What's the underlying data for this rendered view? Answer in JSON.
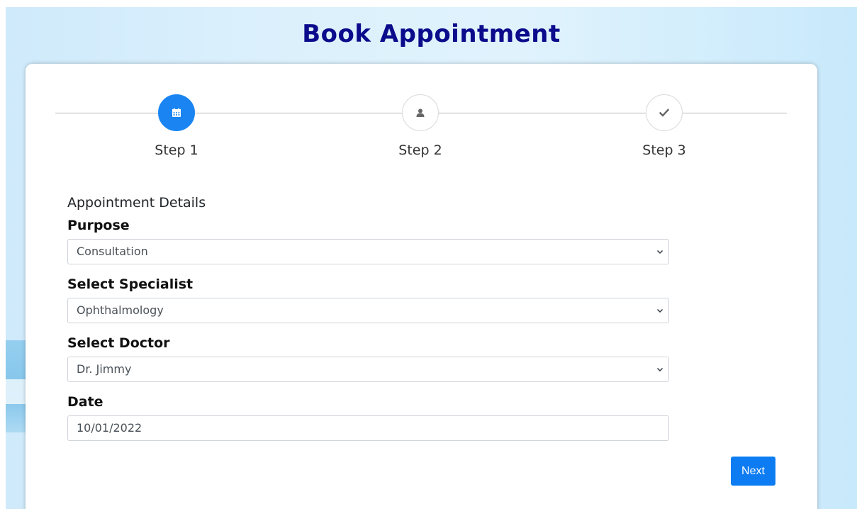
{
  "page": {
    "title": "Book Appointment"
  },
  "stepper": {
    "steps": [
      {
        "label": "Step 1",
        "icon": "calendar-icon",
        "active": true
      },
      {
        "label": "Step 2",
        "icon": "user-icon",
        "active": false
      },
      {
        "label": "Step 3",
        "icon": "check-icon",
        "active": false
      }
    ]
  },
  "form": {
    "section_title": "Appointment Details",
    "purpose": {
      "label": "Purpose",
      "value": "Consultation"
    },
    "specialist": {
      "label": "Select Specialist",
      "value": "Ophthalmology"
    },
    "doctor": {
      "label": "Select Doctor",
      "value": "Dr. Jimmy"
    },
    "date": {
      "label": "Date",
      "value": "10/01/2022"
    }
  },
  "actions": {
    "next_label": "Next"
  },
  "colors": {
    "title": "#0b0b8c",
    "accent": "#1a85f2",
    "button": "#0d7cf2"
  }
}
